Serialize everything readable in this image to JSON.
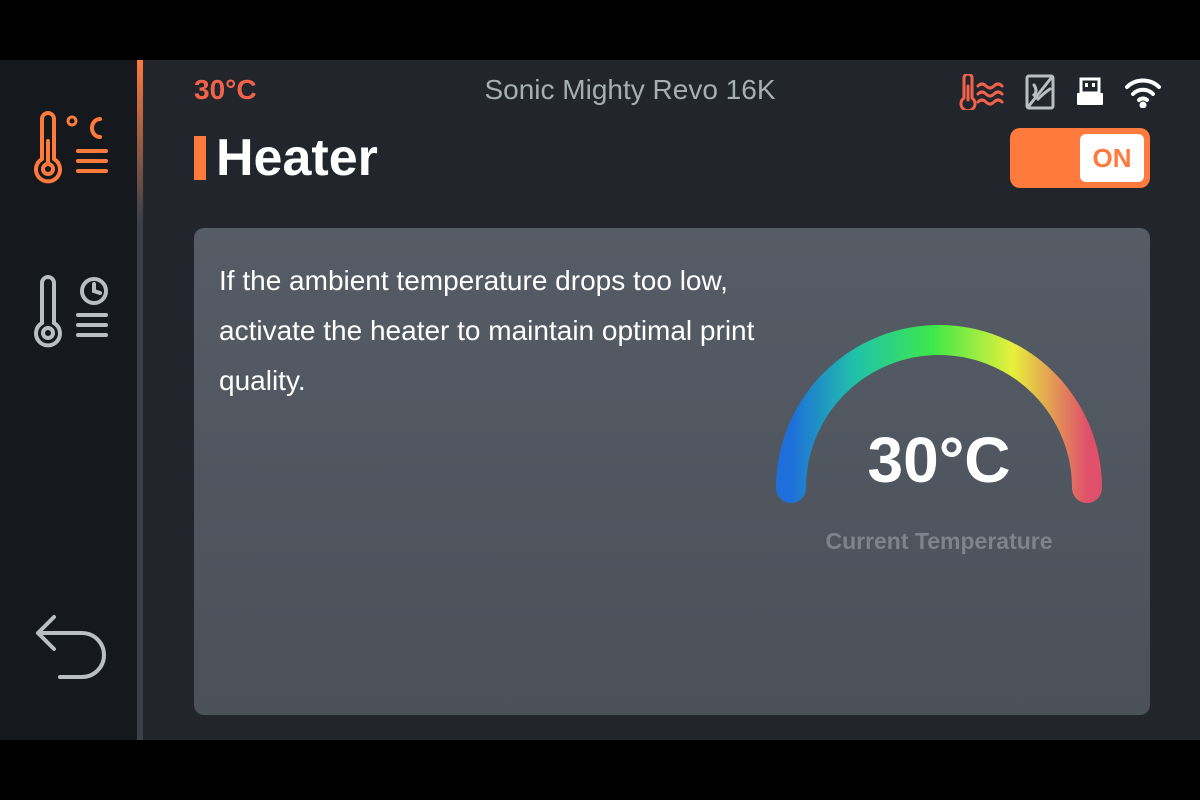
{
  "status_bar": {
    "temperature": "30°C",
    "device_name": "Sonic Mighty Revo 16K",
    "icons": [
      "heater-status-icon",
      "resin-tank-icon",
      "usb-icon",
      "wifi-icon"
    ]
  },
  "sidebar": {
    "items": [
      {
        "name": "heater",
        "icon": "thermometer-celsius-icon",
        "active": true
      },
      {
        "name": "heater-schedule",
        "icon": "thermometer-clock-icon",
        "active": false
      },
      {
        "name": "back",
        "icon": "back-arrow-icon",
        "active": false
      }
    ]
  },
  "header": {
    "title": "Heater",
    "toggle_label": "ON",
    "toggle_state": true
  },
  "card": {
    "description": "If the ambient temperature drops too low, activate the heater to maintain optimal print quality.",
    "gauge_value": "30°C",
    "gauge_label": "Current Temperature"
  },
  "colors": {
    "accent": "#ff7a3d",
    "status_temp": "#f0624a",
    "background": "#22262c",
    "sidebar": "#15181c",
    "card": "#52585f"
  }
}
